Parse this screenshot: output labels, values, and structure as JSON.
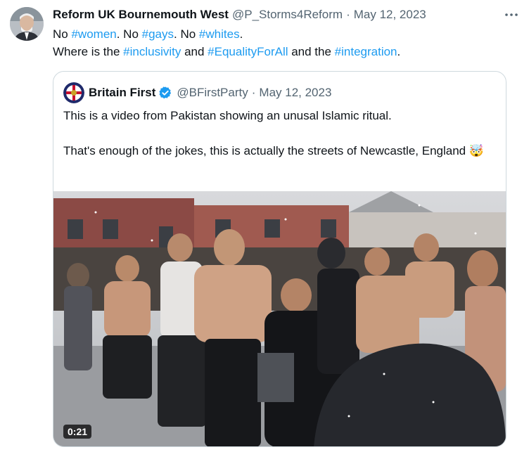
{
  "tweet": {
    "author_name": "Reform UK Bournemouth West",
    "author_handle": "@P_Storms4Reform",
    "separator": "·",
    "date": "May 12, 2023",
    "more_icon": "more-horizontal-icon",
    "line1": {
      "t1": "No ",
      "tag1": "#women",
      "t2": ". No ",
      "tag2": "#gays",
      "t3": ". No ",
      "tag3": "#whites",
      "t4": "."
    },
    "line2": {
      "t1": "Where is the ",
      "tag1": "#inclusivity",
      "t2": " and ",
      "tag2": "#EqualityForAll",
      "t3": " and the ",
      "tag3": "#integration",
      "t4": "."
    }
  },
  "quote": {
    "author_name": "Britain First",
    "author_handle": "@BFirstParty",
    "separator": "·",
    "date": "May 12, 2023",
    "verified_icon": "verified-badge-icon",
    "verified_color": "#1d9bf0",
    "para1": "This is a video from Pakistan showing an unusal Islamic ritual.",
    "para2": "That's enough of the jokes, this is actually the streets of Newcastle, England",
    "emoji": "🤯",
    "video_duration": "0:21"
  },
  "colors": {
    "link": "#1d9bf0",
    "muted": "#536471",
    "border": "#cfd9de",
    "text": "#0f1419"
  }
}
